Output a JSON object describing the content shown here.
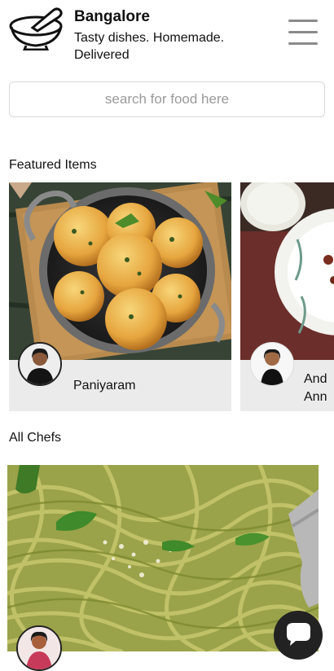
{
  "header": {
    "city": "Bangalore",
    "tagline": "Tasty dishes. Homemade. Delivered",
    "logo_icon": "mortar-pestle-icon",
    "menu_icon": "hamburger-menu-icon"
  },
  "search": {
    "placeholder": "search for food here",
    "value": ""
  },
  "featured": {
    "title": "Featured Items",
    "items": [
      {
        "dish": "Paniyaram",
        "image": "paniyaram-dish-photo",
        "chef": "chef-avatar"
      },
      {
        "dish": "And\nAnn",
        "image": "dish-photo",
        "chef": "chef-avatar"
      }
    ]
  },
  "chefs": {
    "title": "All Chefs",
    "items": [
      {
        "image": "pesto-spaghetti-photo",
        "chef": "chef-avatar"
      }
    ]
  },
  "chat_icon": "chat-bubble-icon"
}
